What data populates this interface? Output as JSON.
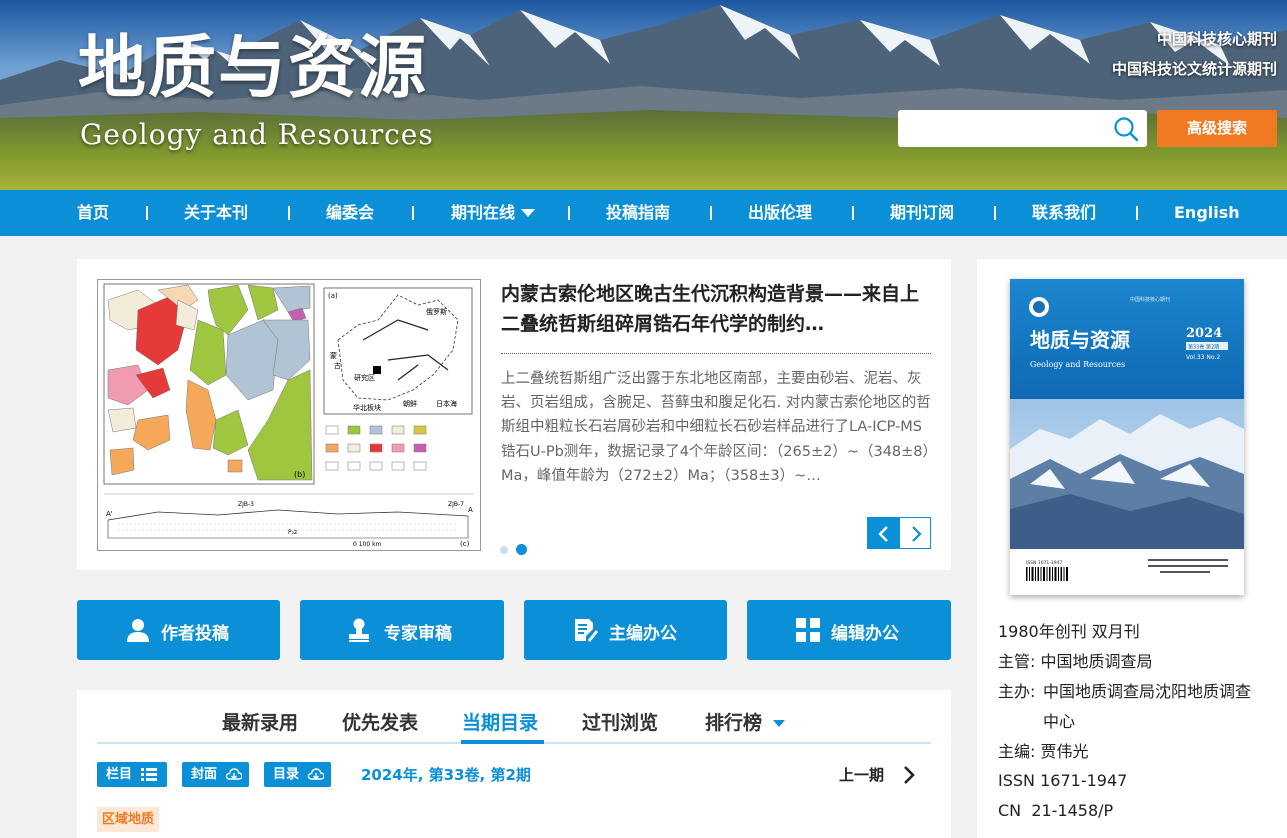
{
  "header": {
    "title_cn": "地质与资源",
    "title_en": "Geology and Resources",
    "tags": [
      "中国科技核心期刊",
      "中国科技论文统计源期刊"
    ],
    "search": {
      "value": "",
      "placeholder": ""
    },
    "advanced_search_label": "高级搜索"
  },
  "nav": {
    "items": [
      "首页",
      "关于本刊",
      "编委会",
      "期刊在线",
      "投稿指南",
      "出版伦理",
      "期刊订阅",
      "联系我们",
      "English"
    ]
  },
  "feature": {
    "title": "内蒙古索伦地区晚古生代沉积构造背景——来自上二叠统哲斯组碎屑锆石年代学的制约…",
    "abstract": "上二叠统哲斯组广泛出露于东北地区南部，主要由砂岩、泥岩、灰岩、页岩组成，含腕足、苔藓虫和腹足化石. 对内蒙古索伦地区的哲斯组中粗粒长石岩屑砂岩和中细粒长石砂岩样品进行了LA-ICP-MS锆石U-Pb测年，数据记录了4个年龄区间：（265±2）~（348±8）Ma，峰值年龄为（272±2）Ma；（358±3）~…",
    "slide_count": 2,
    "active_slide": 2,
    "figure": {
      "panel_b_label": "(b)",
      "panel_a_label": "(a)",
      "panel_c_label": "(c)",
      "study_area_label": "研究区",
      "labels_a": [
        "俄罗斯",
        "蒙",
        "古",
        "华北板块",
        "朝鲜",
        "日本海"
      ],
      "profile_points": [
        "A'",
        "A",
        "ZJB-3",
        "ZJB-7",
        "P₂z"
      ],
      "scale_text": "0    100 km"
    }
  },
  "quick_links": [
    "作者投稿",
    "专家审稿",
    "主编办公",
    "编辑办公"
  ],
  "tabs": {
    "items": [
      "最新录用",
      "优先发表",
      "当期目录",
      "过刊浏览",
      "排行榜"
    ],
    "active": "当期目录",
    "buttons": [
      "栏目",
      "封面",
      "目录"
    ],
    "issue": "2024年, 第33卷, 第2期",
    "prev_label": "上一期",
    "section": "区域地质"
  },
  "sidebar": {
    "cover": {
      "title_cn": "地质与资源",
      "title_en": "Geology and Resources",
      "year": "2024",
      "volume": "Vol.33  No.2",
      "issue_cn": "第33卷 第2期",
      "top_text": "中国科技核心期刊",
      "issn": "ISSN 1671-1947"
    },
    "info": [
      {
        "label": "",
        "text": "1980年创刊    双月刊"
      },
      {
        "label": "主管:",
        "text": "中国地质调查局"
      },
      {
        "label": "主办:",
        "text": "中国地质调查局沈阳地质调查中心"
      },
      {
        "label": "主编:",
        "text": "贾伟光"
      },
      {
        "label": "ISSN",
        "text": "1671-1947"
      },
      {
        "label": "CN",
        "text": "21-1458/P"
      }
    ]
  },
  "colors": {
    "primary": "#0b8fd6",
    "accent": "#f07a22",
    "background": "#f2f2f2"
  }
}
